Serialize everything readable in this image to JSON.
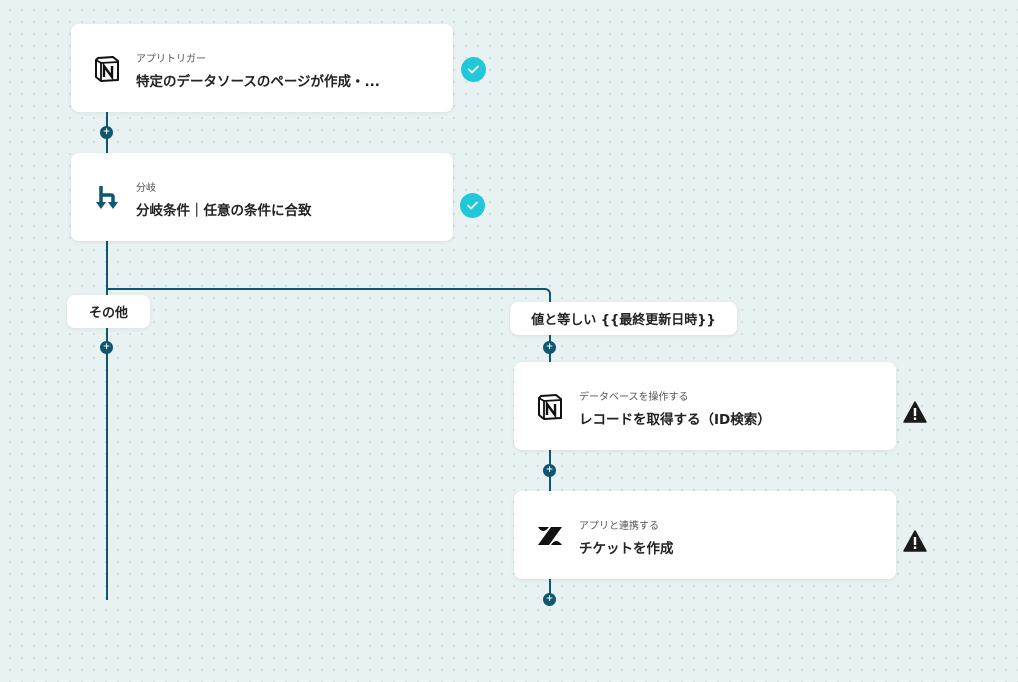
{
  "steps": [
    {
      "sub": "アプリトリガー",
      "title": "特定のデータソースのページが作成・...",
      "icon": "notion-icon",
      "status": "done"
    },
    {
      "sub": "分岐",
      "title": "分岐条件｜任意の条件に合致",
      "icon": "branch-icon",
      "status": "done"
    },
    {
      "sub": "データベースを操作する",
      "title": "レコードを取得する（ID検索）",
      "icon": "notion-icon",
      "status": "warning"
    },
    {
      "sub": "アプリと連携する",
      "title": "チケットを作成",
      "icon": "zendesk-icon",
      "status": "warning"
    }
  ],
  "branches": {
    "other_label": "その他",
    "condition_label": "値と等しい {{最終更新日時}}"
  },
  "colors": {
    "line": "#0f5670",
    "check": "#22c7d9",
    "warning": "#1a1a1a",
    "background": "#e8f2f3"
  }
}
